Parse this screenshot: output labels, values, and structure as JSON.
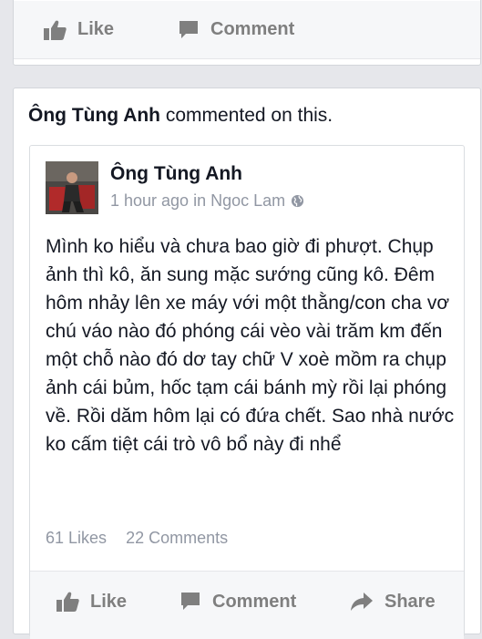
{
  "top_card": {
    "like_label": "Like",
    "comment_label": "Comment"
  },
  "story": {
    "actor": "Ông Tùng Anh",
    "action_text": "commented on this."
  },
  "post": {
    "author": "Ông Tùng Anh",
    "time": "1 hour ago in Ngoc Lam",
    "privacy_icon": "globe-icon",
    "text": "Mình ko hiểu và chưa bao giờ đi phượt. Chụp ảnh thì kô, ăn sung mặc sướng cũng kô. Đêm hôm nhảy lên xe máy với một thằng/con cha vơ chú váo nào đó phóng cái vèo vài trăm km đến một chỗ nào đó dơ tay chữ V xoè mồm ra chụp ảnh cái bủm, hốc tạm cái bánh mỳ rồi lại phóng về. Rồi dăm hôm lại có đứa chết. Sao nhà nước ko cấm tiệt cái trò vô bổ này đi nhể",
    "likes": "61 Likes",
    "comments": "22 Comments",
    "like_label": "Like",
    "comment_label": "Comment",
    "share_label": "Share"
  },
  "colors": {
    "background": "#e6e7eb",
    "action_text": "#7f7f7f",
    "meta_text": "#9197a3"
  }
}
